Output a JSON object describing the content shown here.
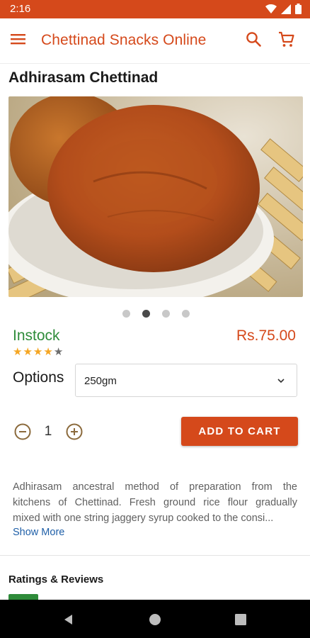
{
  "status_bar": {
    "time": "2:16"
  },
  "app_bar": {
    "title": "Chettinad Snacks Online",
    "icons": [
      "menu-icon",
      "search-icon",
      "cart-icon"
    ]
  },
  "product": {
    "title": "Adhirasam Chettinad",
    "image_count": 4,
    "active_image_index": 1,
    "stock_status": "Instock",
    "price": "Rs.75.00",
    "rating": 4,
    "rating_max": 5
  },
  "options": {
    "label": "Options",
    "selected": "250gm"
  },
  "quantity": {
    "value": "1"
  },
  "actions": {
    "add_to_cart": "ADD TO CART"
  },
  "description": {
    "lines": [
      "Adhirasam ancestral method of preparation from the",
      "kitchens of Chettinad. Fresh ground rice flour gradually",
      "mixed with one string jaggery syrup cooked to the consi..."
    ],
    "show_more": "Show More"
  },
  "reviews": {
    "title": "Ratings & Reviews"
  },
  "colors": {
    "brand": "#d5491b",
    "instock": "#2e8b3a",
    "link": "#1f5fa8",
    "star": "#f5a623"
  }
}
